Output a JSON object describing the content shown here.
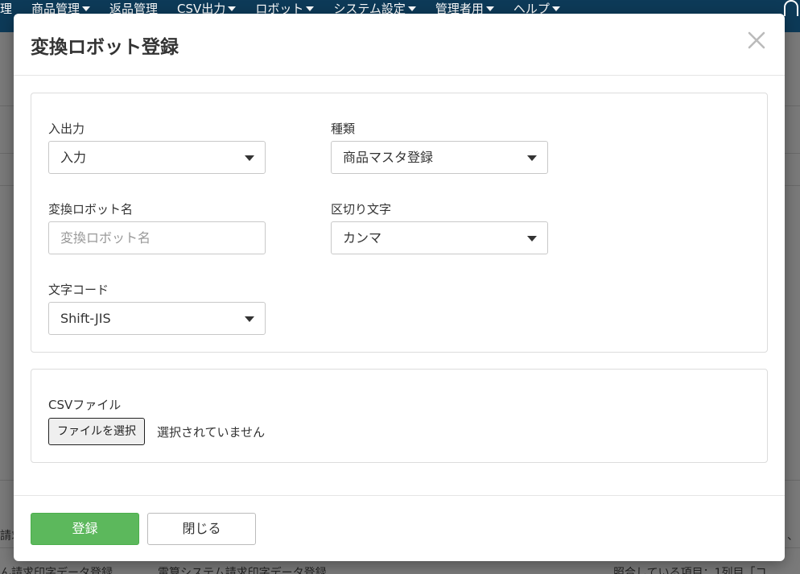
{
  "nav": {
    "items": [
      {
        "label": "理",
        "caret": false
      },
      {
        "label": "商品管理",
        "caret": true
      },
      {
        "label": "返品管理",
        "caret": false
      },
      {
        "label": "CSV出力",
        "caret": true
      },
      {
        "label": "ロボット",
        "caret": true
      },
      {
        "label": "システム設定",
        "caret": true
      },
      {
        "label": "管理者用",
        "caret": true
      },
      {
        "label": "ヘルプ",
        "caret": true
      }
    ],
    "bell_icon": "bell-icon"
  },
  "background": {
    "row_left": "請求",
    "row_right": "、",
    "bottom_cells": [
      "ん請求印字データ登録",
      "電算システム請求印字データ登録",
      "照合している項目：1列目「コ"
    ]
  },
  "modal": {
    "title": "変換ロボット登録",
    "close_icon": "close-icon",
    "fields": {
      "io": {
        "label": "入出力",
        "value": "入力"
      },
      "kind": {
        "label": "種類",
        "value": "商品マスタ登録"
      },
      "robot_name": {
        "label": "変換ロボット名",
        "placeholder": "変換ロボット名",
        "value": ""
      },
      "delimiter": {
        "label": "区切り文字",
        "value": "カンマ"
      },
      "charset": {
        "label": "文字コード",
        "value": "Shift-JIS"
      }
    },
    "csv": {
      "label": "CSVファイル",
      "button": "ファイルを選択",
      "status": "選択されていません"
    },
    "footer": {
      "submit": "登録",
      "close": "閉じる"
    }
  },
  "colors": {
    "navbar": "#0d3a58",
    "primary": "#5cb85c"
  }
}
